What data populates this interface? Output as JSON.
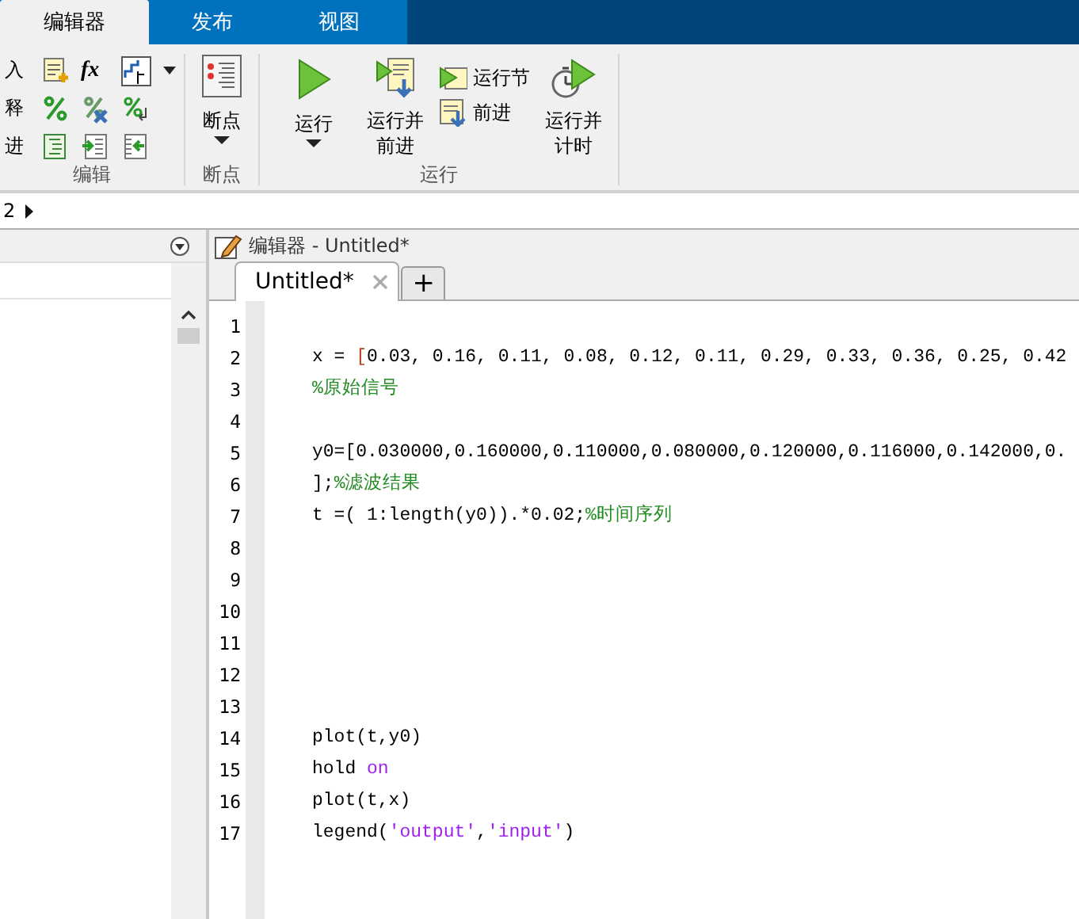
{
  "ribbon_tabs": [
    {
      "label": "编辑器",
      "selected": true
    },
    {
      "label": "发布",
      "selected": false
    },
    {
      "label": "视图",
      "selected": false
    }
  ],
  "toolstrip": {
    "edit": {
      "rows": [
        "入",
        "释",
        "进"
      ],
      "fx": "fx",
      "label": "编辑"
    },
    "breakpoints": {
      "button": "断点",
      "label": "断点"
    },
    "run": {
      "buttons": [
        {
          "kind": "large",
          "label": "运行",
          "dropdown": true
        },
        {
          "kind": "large",
          "label": "运行并前进",
          "dropdown": false
        },
        {
          "kind": "small",
          "labels": [
            "运行节",
            "前进"
          ]
        },
        {
          "kind": "large",
          "label": "运行并计时",
          "dropdown": false
        }
      ],
      "label": "运行"
    }
  },
  "address_bar": {
    "text": "2"
  },
  "editor": {
    "title": "编辑器 - Untitled*",
    "tabs": [
      {
        "label": "Untitled*",
        "selected": true
      }
    ],
    "new_tab": "+",
    "lines": [
      {
        "number": "1"
      },
      {
        "number": "2",
        "tokens": [
          {
            "kind": "code",
            "text": "x = "
          },
          {
            "kind": "match",
            "text": "["
          },
          {
            "kind": "code",
            "text": "0.03, 0.16, 0.11, 0.08, 0.12, 0.11, 0.29, 0.33, 0.36, 0.25, 0.42"
          }
        ]
      },
      {
        "number": "3",
        "tokens": [
          {
            "kind": "comment",
            "text": "%原始信号"
          }
        ]
      },
      {
        "number": "4"
      },
      {
        "number": "5",
        "tokens": [
          {
            "kind": "code",
            "text": "y0=[0.030000,0.160000,0.110000,0.080000,0.120000,0.116000,0.142000,0."
          }
        ]
      },
      {
        "number": "6",
        "tokens": [
          {
            "kind": "code",
            "text": "];"
          },
          {
            "kind": "comment",
            "text": "%滤波结果"
          }
        ]
      },
      {
        "number": "7",
        "tokens": [
          {
            "kind": "code",
            "text": "t =( 1:length(y0)).*0.02;"
          },
          {
            "kind": "comment",
            "text": "%时间序列"
          }
        ]
      },
      {
        "number": "8"
      },
      {
        "number": "9"
      },
      {
        "number": "10"
      },
      {
        "number": "11"
      },
      {
        "number": "12"
      },
      {
        "number": "13"
      },
      {
        "number": "14",
        "tokens": [
          {
            "kind": "code",
            "text": "plot(t,y0)"
          }
        ]
      },
      {
        "number": "15",
        "tokens": [
          {
            "kind": "code",
            "text": "hold "
          },
          {
            "kind": "string",
            "text": "on"
          }
        ]
      },
      {
        "number": "16",
        "tokens": [
          {
            "kind": "code",
            "text": "plot(t,x)"
          }
        ]
      },
      {
        "number": "17",
        "tokens": [
          {
            "kind": "code",
            "text": "legend("
          },
          {
            "kind": "string",
            "text": "'output'"
          },
          {
            "kind": "code",
            "text": ","
          },
          {
            "kind": "string",
            "text": "'input'"
          },
          {
            "kind": "code",
            "text": ")"
          }
        ]
      }
    ]
  }
}
